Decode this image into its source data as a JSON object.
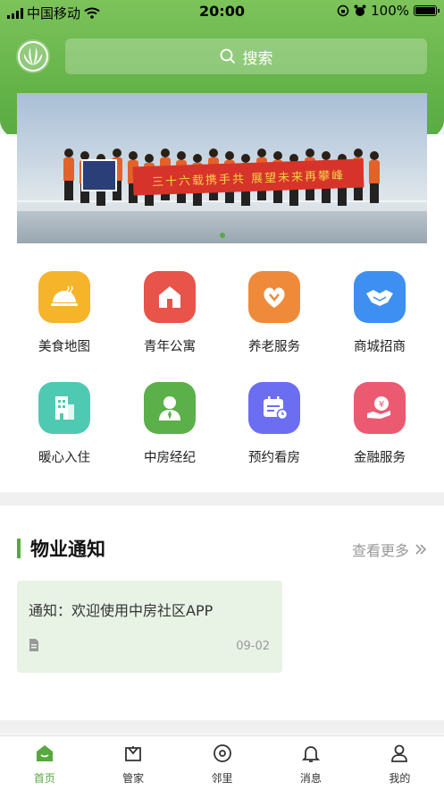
{
  "status_bar": {
    "carrier": "中国移动",
    "time": "20:00",
    "battery": "100%"
  },
  "search": {
    "placeholder": "搜索"
  },
  "banner": {
    "flag_text": "三十六载携手共  展望未来再攀峰",
    "slide_count": 1,
    "active_slide": 0
  },
  "services": [
    {
      "label": "美食地图",
      "icon": "food-cloche-icon",
      "color": "#f5b429"
    },
    {
      "label": "青年公寓",
      "icon": "house-icon",
      "color": "#e8534a"
    },
    {
      "label": "养老服务",
      "icon": "heart-hands-icon",
      "color": "#ef8a3a"
    },
    {
      "label": "商城招商",
      "icon": "handshake-icon",
      "color": "#3d8ff2"
    },
    {
      "label": "暖心入住",
      "icon": "building-icon",
      "color": "#4ecab3"
    },
    {
      "label": "中房经纪",
      "icon": "agent-icon",
      "color": "#5bb04a"
    },
    {
      "label": "预约看房",
      "icon": "calendar-icon",
      "color": "#6b6ef0"
    },
    {
      "label": "金融服务",
      "icon": "finance-icon",
      "color": "#ec5a72"
    }
  ],
  "notice": {
    "title": "物业通知",
    "more": "查看更多",
    "card": {
      "text": "通知：欢迎使用中房社区APP",
      "date": "09-02"
    }
  },
  "tabs": [
    {
      "label": "首页",
      "icon": "home-icon",
      "active": true
    },
    {
      "label": "管家",
      "icon": "butler-icon",
      "active": false
    },
    {
      "label": "邻里",
      "icon": "neighbor-icon",
      "active": false
    },
    {
      "label": "消息",
      "icon": "bell-icon",
      "active": false
    },
    {
      "label": "我的",
      "icon": "profile-icon",
      "active": false
    }
  ],
  "colors": {
    "brand_green": "#56a83f",
    "card_bg": "#e8f3e6"
  }
}
